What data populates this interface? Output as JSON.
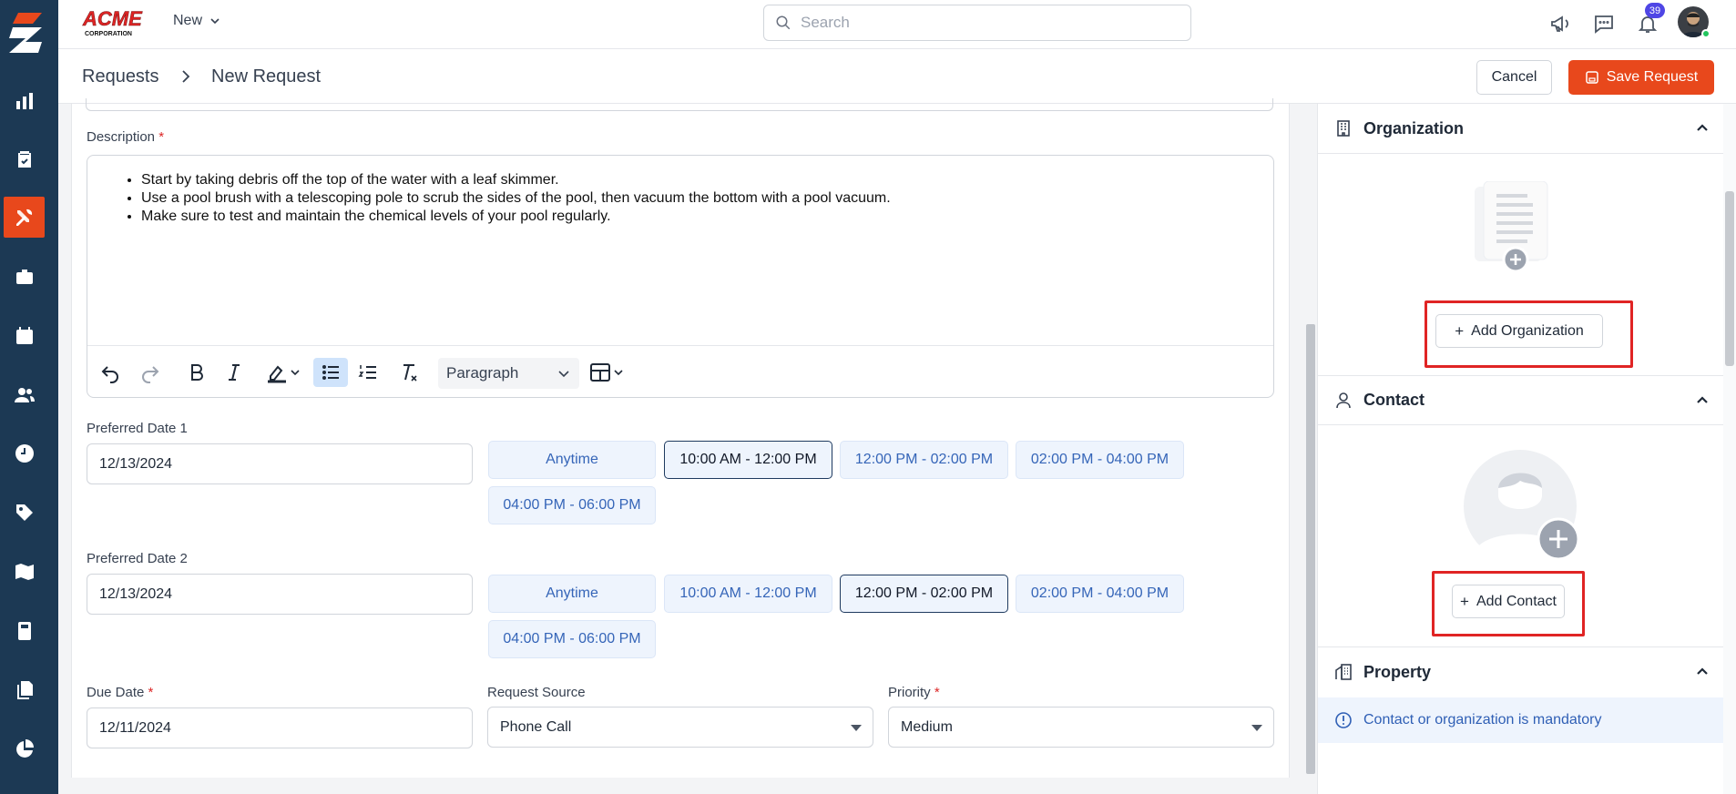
{
  "sidebar": {
    "items": [
      "reports-icon",
      "checklist-icon",
      "tools-icon",
      "briefcase-icon",
      "calendar-icon",
      "users-icon",
      "clock-icon",
      "tag-icon",
      "map-icon",
      "calculator-icon",
      "documents-icon",
      "pie-chart-icon"
    ],
    "active": "tools-icon",
    "background": "#1c3954",
    "accent": "#e8481c"
  },
  "topbar": {
    "brand_name": "ACME",
    "brand_sub": "CORPORATION",
    "new_label": "New",
    "search_placeholder": "Search",
    "notification_count": "39"
  },
  "header": {
    "breadcrumb_root": "Requests",
    "breadcrumb_current": "New Request",
    "cancel_label": "Cancel",
    "save_label": "Save Request"
  },
  "form": {
    "description_label": "Description",
    "required_mark": "*",
    "description_items": [
      "Start by taking debris off the top of the water with a leaf skimmer.",
      "Use a pool brush with a telescoping pole to scrub the sides of the pool, then vacuum the bottom with a pool vacuum.",
      "Make sure to test and maintain the chemical levels of your pool regularly."
    ],
    "paragraph_style": "Paragraph",
    "preferred_date_1": {
      "label": "Preferred Date 1",
      "value": "12/13/2024",
      "slots": [
        "Anytime",
        "10:00 AM - 12:00 PM",
        "12:00 PM - 02:00 PM",
        "02:00 PM - 04:00 PM",
        "04:00 PM - 06:00 PM"
      ],
      "selected": "10:00 AM - 12:00 PM"
    },
    "preferred_date_2": {
      "label": "Preferred Date 2",
      "value": "12/13/2024",
      "slots": [
        "Anytime",
        "10:00 AM - 12:00 PM",
        "12:00 PM - 02:00 PM",
        "02:00 PM - 04:00 PM",
        "04:00 PM - 06:00 PM"
      ],
      "selected": "12:00 PM - 02:00 PM"
    },
    "due_date": {
      "label": "Due Date",
      "value": "12/11/2024"
    },
    "request_source": {
      "label": "Request Source",
      "value": "Phone Call"
    },
    "priority": {
      "label": "Priority",
      "value": "Medium"
    }
  },
  "right_panel": {
    "organization": {
      "title": "Organization",
      "add_label": "Add Organization"
    },
    "contact": {
      "title": "Contact",
      "add_label": "Add Contact"
    },
    "property": {
      "title": "Property",
      "info": "Contact or organization is mandatory"
    }
  }
}
